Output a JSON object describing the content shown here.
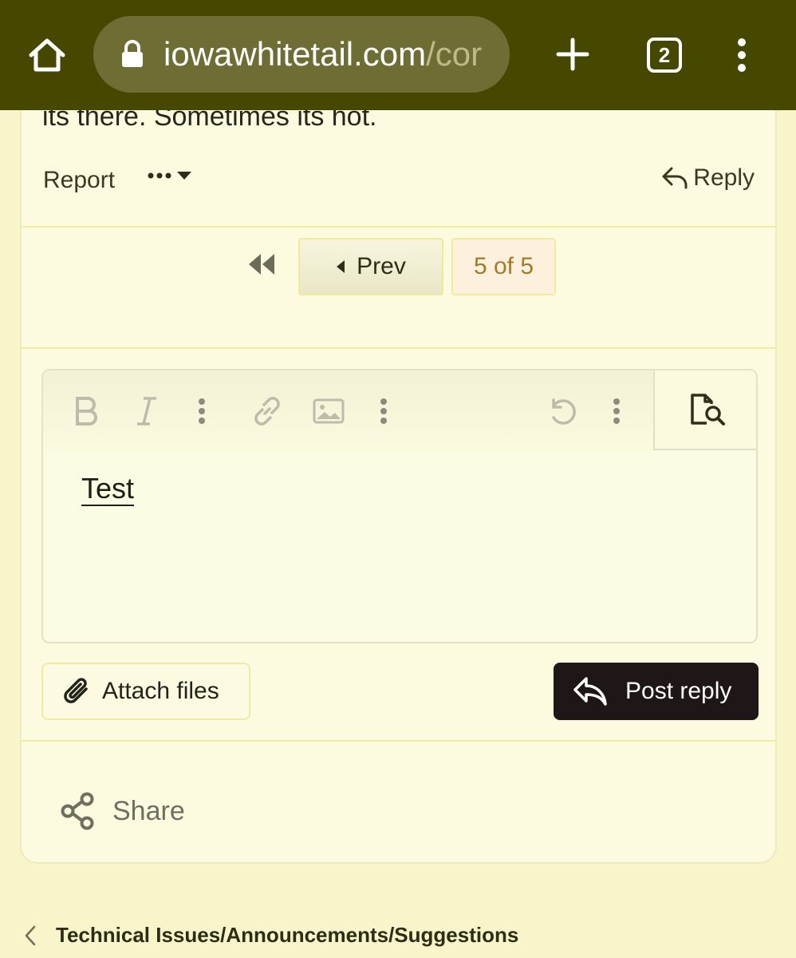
{
  "browser": {
    "url_domain": "iowawhitetail.com",
    "url_path": "/cor",
    "tab_count": "2",
    "icons": [
      "home-icon",
      "lock-icon",
      "plus-icon",
      "more-vert-icon"
    ]
  },
  "post": {
    "text": "its there. Sometimes its hot.",
    "report_label": "Report",
    "reply_label": "Reply"
  },
  "pagination": {
    "prev_label": "Prev",
    "current": "5 of 5"
  },
  "editor": {
    "content": "Test",
    "toolbar_icons": [
      "bold-icon",
      "italic-icon",
      "more-options-icon",
      "link-icon",
      "image-icon",
      "more-options-icon",
      "undo-icon",
      "more-options-icon",
      "preview-icon"
    ]
  },
  "actions": {
    "attach_label": "Attach files",
    "post_reply_label": "Post reply",
    "share_label": "Share"
  },
  "breadcrumb": {
    "label": "Technical Issues/Announcements/Suggestions"
  },
  "colors": {
    "browser_bar": "#464800",
    "page_bg": "#f7f5c9",
    "card_bg": "#fcfbe0",
    "post_button": "#1f1717",
    "page_indicator_text": "#a37b25"
  }
}
